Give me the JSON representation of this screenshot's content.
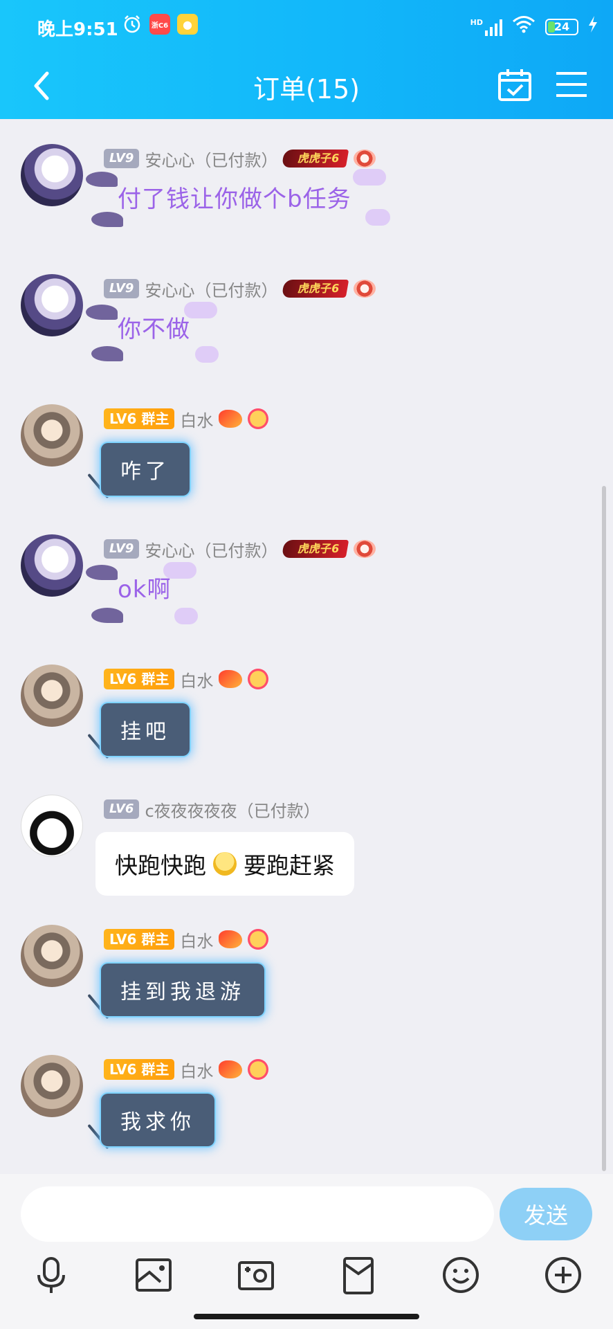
{
  "status_bar": {
    "time": "晚上9:51",
    "left_icons": [
      "alarm-clock-icon",
      "app-notification-icon",
      "coin-app-icon"
    ],
    "app_icon_text": "浙C6",
    "signal_label": "HD",
    "battery": "24",
    "battery_fraction": 0.24
  },
  "header": {
    "title": "订单(15)",
    "back_icon": "chevron-left-icon",
    "calendar_icon": "calendar-check-icon",
    "menu_icon": "hamburger-menu-icon"
  },
  "colors": {
    "header": "#12b7fa",
    "purple_text": "#9b63e8",
    "dark_bubble": "#4a5d77",
    "owner_badge": "#ffa313",
    "send_button": "#8ed0f6"
  },
  "messages": [
    {
      "level": "LV9",
      "sender": "安心心（已付款）",
      "badge": "虎虎子6",
      "text": "付了钱让你做个b任务"
    },
    {
      "level": "LV9",
      "sender": "安心心（已付款）",
      "badge": "虎虎子6",
      "text": "你不做"
    },
    {
      "level": "LV6",
      "role": "群主",
      "sender": "白水",
      "text": "咋了"
    },
    {
      "level": "LV9",
      "sender": "安心心（已付款）",
      "badge": "虎虎子6",
      "text": "ok啊"
    },
    {
      "level": "LV6",
      "role": "群主",
      "sender": "白水",
      "text": "挂吧"
    },
    {
      "level": "LV6",
      "sender": "c夜夜夜夜夜（已付款）",
      "text_before": "快跑快跑",
      "text_after": "要跑赶紧"
    },
    {
      "level": "LV6",
      "role": "群主",
      "sender": "白水",
      "text": "挂到我退游"
    },
    {
      "level": "LV6",
      "role": "群主",
      "sender": "白水",
      "text": "我求你"
    }
  ],
  "composer": {
    "placeholder": "",
    "send_label": "发送"
  },
  "toolbar": [
    "microphone-icon",
    "image-icon",
    "camera-icon",
    "red-packet-icon",
    "emoji-icon",
    "plus-icon"
  ]
}
